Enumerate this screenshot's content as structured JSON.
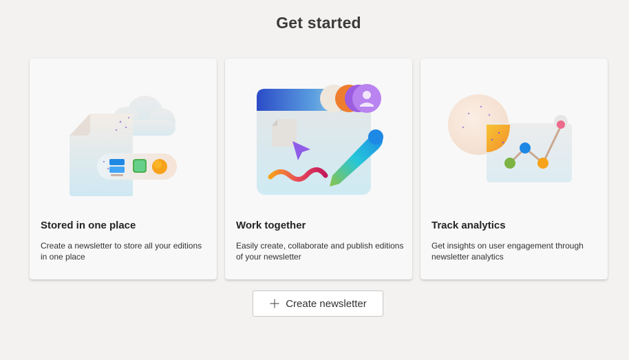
{
  "header": {
    "title": "Get started"
  },
  "cards": [
    {
      "title": "Stored in one place",
      "description": "Create a newsletter to store all your editions in one place",
      "illustration": "cloud-document-storage-illustration"
    },
    {
      "title": "Work together",
      "description": "Easily create, collaborate and publish editions of your newsletter",
      "illustration": "collaboration-canvas-illustration"
    },
    {
      "title": "Track analytics",
      "description": "Get insights on user engagement through newsletter analytics",
      "illustration": "analytics-chart-illustration"
    }
  ],
  "actions": {
    "create_label": "Create newsletter",
    "create_icon": "plus-icon"
  },
  "colors": {
    "background": "#f3f2f1",
    "card": "#f8f8f8",
    "text": "#242424"
  }
}
